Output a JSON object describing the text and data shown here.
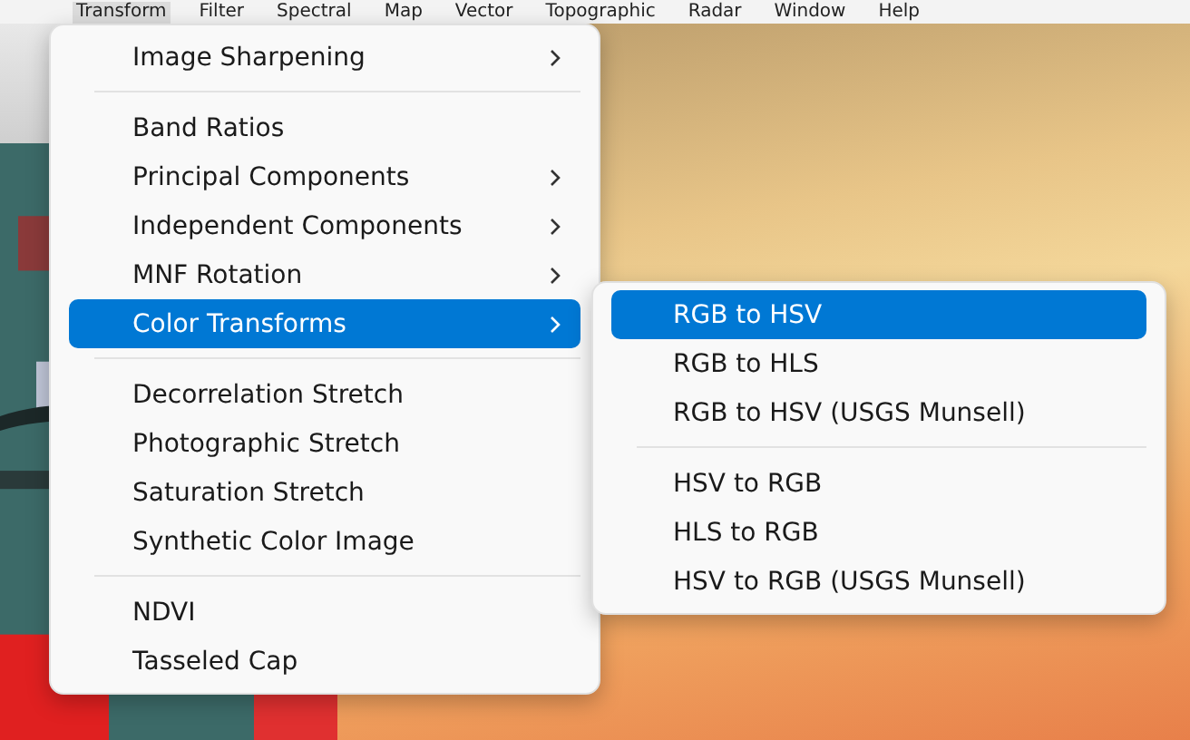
{
  "menu_bar": [
    {
      "label": "Transform",
      "selected": true
    },
    {
      "label": "Filter",
      "selected": false
    },
    {
      "label": "Spectral",
      "selected": false
    },
    {
      "label": "Map",
      "selected": false
    },
    {
      "label": "Vector",
      "selected": false
    },
    {
      "label": "Topographic",
      "selected": false
    },
    {
      "label": "Radar",
      "selected": false
    },
    {
      "label": "Window",
      "selected": false
    },
    {
      "label": "Help",
      "selected": false
    }
  ],
  "transform_menu": {
    "items": [
      {
        "kind": "item",
        "label": "Image Sharpening",
        "submenu": true,
        "selected": false
      },
      {
        "kind": "separator"
      },
      {
        "kind": "item",
        "label": "Band Ratios",
        "submenu": false,
        "selected": false
      },
      {
        "kind": "item",
        "label": "Principal Components",
        "submenu": true,
        "selected": false
      },
      {
        "kind": "item",
        "label": "Independent Components",
        "submenu": true,
        "selected": false
      },
      {
        "kind": "item",
        "label": "MNF Rotation",
        "submenu": true,
        "selected": false
      },
      {
        "kind": "item",
        "label": "Color Transforms",
        "submenu": true,
        "selected": true
      },
      {
        "kind": "separator"
      },
      {
        "kind": "item",
        "label": "Decorrelation Stretch",
        "submenu": false,
        "selected": false
      },
      {
        "kind": "item",
        "label": "Photographic Stretch",
        "submenu": false,
        "selected": false
      },
      {
        "kind": "item",
        "label": "Saturation Stretch",
        "submenu": false,
        "selected": false
      },
      {
        "kind": "item",
        "label": "Synthetic Color Image",
        "submenu": false,
        "selected": false
      },
      {
        "kind": "separator"
      },
      {
        "kind": "item",
        "label": "NDVI",
        "submenu": false,
        "selected": false
      },
      {
        "kind": "item",
        "label": "Tasseled Cap",
        "submenu": false,
        "selected": false
      }
    ]
  },
  "color_transforms_submenu": {
    "items": [
      {
        "kind": "item",
        "label": "RGB to HSV",
        "submenu": false,
        "selected": true
      },
      {
        "kind": "item",
        "label": "RGB to HLS",
        "submenu": false,
        "selected": false
      },
      {
        "kind": "item",
        "label": "RGB to HSV (USGS Munsell)",
        "submenu": false,
        "selected": false
      },
      {
        "kind": "separator"
      },
      {
        "kind": "item",
        "label": "HSV to RGB",
        "submenu": false,
        "selected": false
      },
      {
        "kind": "item",
        "label": "HLS to RGB",
        "submenu": false,
        "selected": false
      },
      {
        "kind": "item",
        "label": "HSV to RGB (USGS Munsell)",
        "submenu": false,
        "selected": false
      }
    ]
  }
}
